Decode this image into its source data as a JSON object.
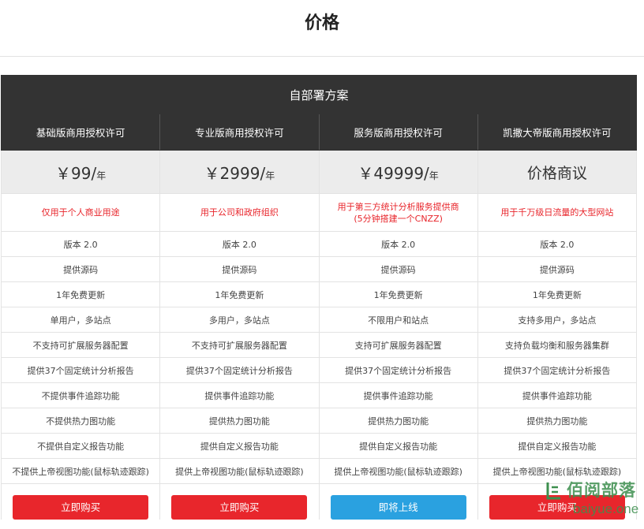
{
  "page": {
    "title": "价格"
  },
  "plans_heading": "自部署方案",
  "plans": [
    {
      "name": "基础版商用授权许可",
      "price": "￥99/",
      "unit": "年",
      "usage": "仅用于个人商业用途",
      "features": [
        "版本 2.0",
        "提供源码",
        "1年免费更新",
        "单用户，多站点",
        "不支持可扩展服务器配置",
        "提供37个固定统计分析报告",
        "不提供事件追踪功能",
        "不提供热力图功能",
        "不提供自定义报告功能",
        "不提供上帝视图功能(鼠标轨迹跟踪)"
      ],
      "button": "立即购买",
      "button_color": "#e8262c"
    },
    {
      "name": "专业版商用授权许可",
      "price": "￥2999/",
      "unit": "年",
      "usage": "用于公司和政府组织",
      "features": [
        "版本 2.0",
        "提供源码",
        "1年免费更新",
        "多用户，多站点",
        "不支持可扩展服务器配置",
        "提供37个固定统计分析报告",
        "提供事件追踪功能",
        "提供热力图功能",
        "提供自定义报告功能",
        "提供上帝视图功能(鼠标轨迹跟踪)"
      ],
      "button": "立即购买",
      "button_color": "#e8262c"
    },
    {
      "name": "服务版商用授权许可",
      "price": "￥49999/",
      "unit": "年",
      "usage": "用于第三方统计分析服务提供商",
      "usage_line2": "(5分钟搭建一个CNZZ)",
      "features": [
        "版本 2.0",
        "提供源码",
        "1年免费更新",
        "不限用户和站点",
        "支持可扩展服务器配置",
        "提供37个固定统计分析报告",
        "提供事件追踪功能",
        "提供热力图功能",
        "提供自定义报告功能",
        "提供上帝视图功能(鼠标轨迹跟踪)"
      ],
      "button": "即将上线",
      "button_color": "#2aa1e0"
    },
    {
      "name": "凯撒大帝版商用授权许可",
      "price": "价格商议",
      "usage": "用于千万级日流量的大型网站",
      "features": [
        "版本 2.0",
        "提供源码",
        "1年免费更新",
        "支持多用户，多站点",
        "支持负载均衡和服务器集群",
        "提供37个固定统计分析报告",
        "提供事件追踪功能",
        "提供热力图功能",
        "提供自定义报告功能",
        "提供上帝视图功能(鼠标轨迹跟踪)"
      ],
      "button": "立即购买",
      "button_color": "#e8262c"
    }
  ],
  "watermark": {
    "cn": "佰阅部落",
    "en": "baiyue.one",
    "color": "#3d8f4e"
  }
}
